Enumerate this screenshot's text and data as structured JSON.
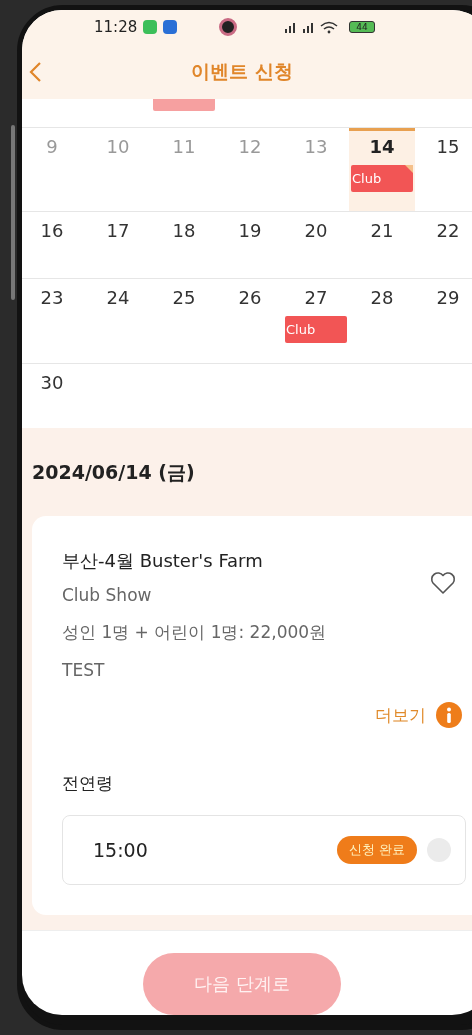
{
  "status_bar": {
    "time": "11:28",
    "battery": "44"
  },
  "header": {
    "title": "이벤트 신청"
  },
  "calendar": {
    "weeks": [
      [
        {
          "day": "9",
          "muted": true,
          "selected": false
        },
        {
          "day": "10",
          "muted": true,
          "selected": false
        },
        {
          "day": "11",
          "muted": true,
          "selected": false
        },
        {
          "day": "12",
          "muted": true,
          "selected": false
        },
        {
          "day": "13",
          "muted": true,
          "selected": false
        },
        {
          "day": "14",
          "muted": false,
          "selected": true,
          "events": [
            {
              "label": "Club",
              "flagged": true
            }
          ]
        },
        {
          "day": "15",
          "muted": false,
          "selected": false
        }
      ],
      [
        {
          "day": "16",
          "muted": false,
          "selected": false
        },
        {
          "day": "17",
          "muted": false,
          "selected": false
        },
        {
          "day": "18",
          "muted": false,
          "selected": false
        },
        {
          "day": "19",
          "muted": false,
          "selected": false
        },
        {
          "day": "20",
          "muted": false,
          "selected": false
        },
        {
          "day": "21",
          "muted": false,
          "selected": false
        },
        {
          "day": "22",
          "muted": false,
          "selected": false
        }
      ],
      [
        {
          "day": "23",
          "muted": false,
          "selected": false
        },
        {
          "day": "24",
          "muted": false,
          "selected": false
        },
        {
          "day": "25",
          "muted": false,
          "selected": false
        },
        {
          "day": "26",
          "muted": false,
          "selected": false
        },
        {
          "day": "27",
          "muted": false,
          "selected": false,
          "events": [
            {
              "label": "Club",
              "flagged": false
            }
          ]
        },
        {
          "day": "28",
          "muted": false,
          "selected": false
        },
        {
          "day": "29",
          "muted": false,
          "selected": false
        }
      ],
      [
        {
          "day": "30",
          "muted": false,
          "selected": false
        }
      ]
    ]
  },
  "selected_date": "2024/06/14 (금)",
  "event_card": {
    "title": "부산-4월 Buster's Farm",
    "subtitle": "Club Show",
    "price": "성인 1명 + 어린이 1명: 22,000원",
    "note": "TEST",
    "favorite": false,
    "more_link": "더보기",
    "category": "전연령",
    "slots": [
      {
        "time": "15:00",
        "badge": "신청 완료",
        "selected": false
      }
    ]
  },
  "next_button": {
    "label": "다음 단계로",
    "disabled": true
  }
}
